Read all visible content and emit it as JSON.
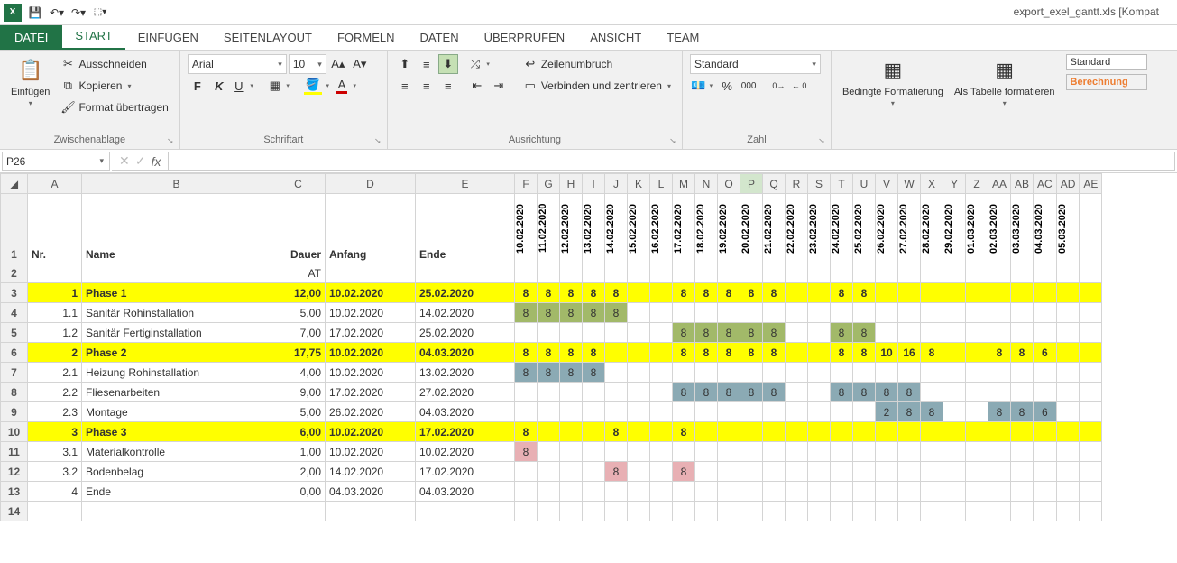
{
  "window_title": "export_exel_gantt.xls  [Kompat",
  "tabs": {
    "file": "DATEI",
    "items": [
      "START",
      "EINFÜGEN",
      "SEITENLAYOUT",
      "FORMELN",
      "DATEN",
      "ÜBERPRÜFEN",
      "ANSICHT",
      "TEAM"
    ],
    "active": 0
  },
  "clipboard": {
    "paste": "Einfügen",
    "cut": "Ausschneiden",
    "copy": "Kopieren",
    "format_painter": "Format übertragen",
    "group": "Zwischenablage"
  },
  "font": {
    "name": "Arial",
    "size": "10",
    "group": "Schriftart"
  },
  "alignment": {
    "wrap": "Zeilenumbruch",
    "merge": "Verbinden und zentrieren",
    "group": "Ausrichtung"
  },
  "number": {
    "format": "Standard",
    "group": "Zahl"
  },
  "styles": {
    "cond": "Bedingte Formatierung",
    "table": "Als Tabelle formatieren",
    "normal": "Standard",
    "calc": "Berechnung"
  },
  "name_box": "P26",
  "columns": [
    "A",
    "B",
    "C",
    "D",
    "E",
    "F",
    "G",
    "H",
    "I",
    "J",
    "K",
    "L",
    "M",
    "N",
    "O",
    "P",
    "Q",
    "R",
    "S",
    "T",
    "U",
    "V",
    "W",
    "X",
    "Y",
    "Z",
    "AA",
    "AB",
    "AC",
    "AD",
    "AE"
  ],
  "headers": {
    "nr": "Nr.",
    "name": "Name",
    "dauer": "Dauer",
    "anfang": "Anfang",
    "ende": "Ende",
    "at": "AT"
  },
  "dates": [
    "10.02.2020",
    "11.02.2020",
    "12.02.2020",
    "13.02.2020",
    "14.02.2020",
    "15.02.2020",
    "16.02.2020",
    "17.02.2020",
    "18.02.2020",
    "19.02.2020",
    "20.02.2020",
    "21.02.2020",
    "22.02.2020",
    "23.02.2020",
    "24.02.2020",
    "25.02.2020",
    "26.02.2020",
    "27.02.2020",
    "28.02.2020",
    "29.02.2020",
    "01.03.2020",
    "02.03.2020",
    "03.03.2020",
    "04.03.2020",
    "05.03.2020"
  ],
  "rows": [
    {
      "phase": true,
      "nr": "1",
      "name": "Phase 1",
      "dauer": "12,00",
      "anfang": "10.02.2020",
      "ende": "25.02.2020",
      "cells": [
        {
          "i": 0,
          "v": "8"
        },
        {
          "i": 1,
          "v": "8"
        },
        {
          "i": 2,
          "v": "8"
        },
        {
          "i": 3,
          "v": "8"
        },
        {
          "i": 4,
          "v": "8"
        },
        {
          "i": 7,
          "v": "8"
        },
        {
          "i": 8,
          "v": "8"
        },
        {
          "i": 9,
          "v": "8"
        },
        {
          "i": 10,
          "v": "8"
        },
        {
          "i": 11,
          "v": "8"
        },
        {
          "i": 14,
          "v": "8"
        },
        {
          "i": 15,
          "v": "8"
        }
      ]
    },
    {
      "nr": "1.1",
      "name": "Sanitär Rohinstallation",
      "dauer": "5,00",
      "anfang": "10.02.2020",
      "ende": "14.02.2020",
      "cells": [
        {
          "i": 0,
          "v": "8",
          "c": "olive"
        },
        {
          "i": 1,
          "v": "8",
          "c": "olive"
        },
        {
          "i": 2,
          "v": "8",
          "c": "olive"
        },
        {
          "i": 3,
          "v": "8",
          "c": "olive"
        },
        {
          "i": 4,
          "v": "8",
          "c": "olive"
        }
      ]
    },
    {
      "nr": "1.2",
      "name": "Sanitär Fertiginstallation",
      "dauer": "7,00",
      "anfang": "17.02.2020",
      "ende": "25.02.2020",
      "cells": [
        {
          "i": 7,
          "v": "8",
          "c": "olive"
        },
        {
          "i": 8,
          "v": "8",
          "c": "olive"
        },
        {
          "i": 9,
          "v": "8",
          "c": "olive"
        },
        {
          "i": 10,
          "v": "8",
          "c": "olive"
        },
        {
          "i": 11,
          "v": "8",
          "c": "olive"
        },
        {
          "i": 14,
          "v": "8",
          "c": "olive"
        },
        {
          "i": 15,
          "v": "8",
          "c": "olive"
        }
      ]
    },
    {
      "phase": true,
      "nr": "2",
      "name": "Phase 2",
      "dauer": "17,75",
      "anfang": "10.02.2020",
      "ende": "04.03.2020",
      "cells": [
        {
          "i": 0,
          "v": "8"
        },
        {
          "i": 1,
          "v": "8"
        },
        {
          "i": 2,
          "v": "8"
        },
        {
          "i": 3,
          "v": "8"
        },
        {
          "i": 7,
          "v": "8"
        },
        {
          "i": 8,
          "v": "8"
        },
        {
          "i": 9,
          "v": "8"
        },
        {
          "i": 10,
          "v": "8"
        },
        {
          "i": 11,
          "v": "8"
        },
        {
          "i": 14,
          "v": "8"
        },
        {
          "i": 15,
          "v": "8"
        },
        {
          "i": 16,
          "v": "10"
        },
        {
          "i": 17,
          "v": "16"
        },
        {
          "i": 18,
          "v": "8"
        },
        {
          "i": 21,
          "v": "8"
        },
        {
          "i": 22,
          "v": "8"
        },
        {
          "i": 23,
          "v": "6"
        }
      ]
    },
    {
      "nr": "2.1",
      "name": "Heizung Rohinstallation",
      "dauer": "4,00",
      "anfang": "10.02.2020",
      "ende": "13.02.2020",
      "cells": [
        {
          "i": 0,
          "v": "8",
          "c": "steel"
        },
        {
          "i": 1,
          "v": "8",
          "c": "steel"
        },
        {
          "i": 2,
          "v": "8",
          "c": "steel"
        },
        {
          "i": 3,
          "v": "8",
          "c": "steel"
        }
      ]
    },
    {
      "nr": "2.2",
      "name": "Fliesenarbeiten",
      "dauer": "9,00",
      "anfang": "17.02.2020",
      "ende": "27.02.2020",
      "cells": [
        {
          "i": 7,
          "v": "8",
          "c": "steel"
        },
        {
          "i": 8,
          "v": "8",
          "c": "steel"
        },
        {
          "i": 9,
          "v": "8",
          "c": "steel"
        },
        {
          "i": 10,
          "v": "8",
          "c": "steel"
        },
        {
          "i": 11,
          "v": "8",
          "c": "steel"
        },
        {
          "i": 14,
          "v": "8",
          "c": "steel"
        },
        {
          "i": 15,
          "v": "8",
          "c": "steel"
        },
        {
          "i": 16,
          "v": "8",
          "c": "steel"
        },
        {
          "i": 17,
          "v": "8",
          "c": "steel"
        }
      ]
    },
    {
      "nr": "2.3",
      "name": "Montage",
      "dauer": "5,00",
      "anfang": "26.02.2020",
      "ende": "04.03.2020",
      "cells": [
        {
          "i": 16,
          "v": "2",
          "c": "steel"
        },
        {
          "i": 17,
          "v": "8",
          "c": "steel"
        },
        {
          "i": 18,
          "v": "8",
          "c": "steel"
        },
        {
          "i": 21,
          "v": "8",
          "c": "steel"
        },
        {
          "i": 22,
          "v": "8",
          "c": "steel"
        },
        {
          "i": 23,
          "v": "6",
          "c": "steel"
        }
      ]
    },
    {
      "phase": true,
      "nr": "3",
      "name": "Phase 3",
      "dauer": "6,00",
      "anfang": "10.02.2020",
      "ende": "17.02.2020",
      "cells": [
        {
          "i": 0,
          "v": "8"
        },
        {
          "i": 4,
          "v": "8"
        },
        {
          "i": 7,
          "v": "8"
        }
      ]
    },
    {
      "nr": "3.1",
      "name": "Materialkontrolle",
      "dauer": "1,00",
      "anfang": "10.02.2020",
      "ende": "10.02.2020",
      "cells": [
        {
          "i": 0,
          "v": "8",
          "c": "pink"
        }
      ]
    },
    {
      "nr": "3.2",
      "name": "Bodenbelag",
      "dauer": "2,00",
      "anfang": "14.02.2020",
      "ende": "17.02.2020",
      "cells": [
        {
          "i": 4,
          "v": "8",
          "c": "pink"
        },
        {
          "i": 7,
          "v": "8",
          "c": "pink"
        }
      ]
    },
    {
      "nr": "4",
      "name": "Ende",
      "dauer": "0,00",
      "anfang": "04.03.2020",
      "ende": "04.03.2020",
      "cells": []
    }
  ]
}
